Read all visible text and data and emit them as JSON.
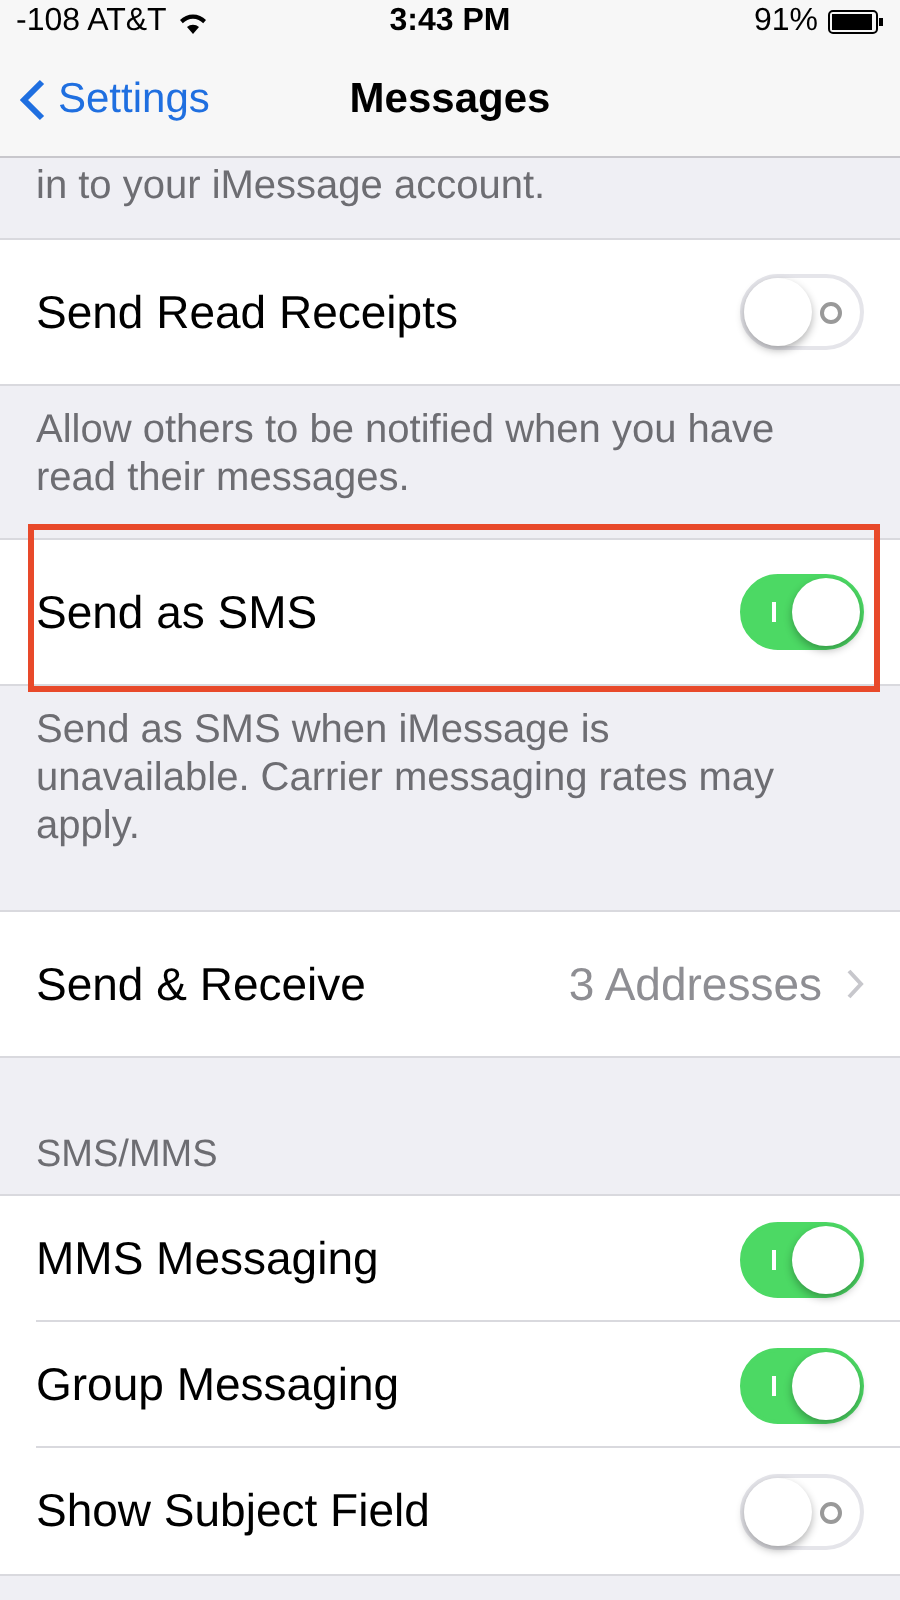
{
  "status_bar": {
    "carrier": "-108 AT&T",
    "time": "3:43 PM",
    "battery": "91%"
  },
  "nav_bar": {
    "back": "Settings",
    "title": "Messages"
  },
  "sections": [
    {
      "kind": "note",
      "text": "in to your iMessage account."
    },
    {
      "kind": "group",
      "rows": [
        {
          "kind": "toggle",
          "label": "Send Read Receipts",
          "on": false,
          "highlighted": false
        }
      ]
    },
    {
      "kind": "note",
      "text": "Allow others to be notified when you have read their messages."
    },
    {
      "kind": "group",
      "rows": [
        {
          "kind": "toggle",
          "label": "Send as SMS",
          "on": true,
          "highlighted": true
        }
      ]
    },
    {
      "kind": "note",
      "text": "Send as SMS when iMessage is unavailable. Carrier messaging rates may apply."
    },
    {
      "kind": "group",
      "rows": [
        {
          "kind": "detail",
          "label": "Send & Receive",
          "value": "3 Addresses",
          "highlighted": false
        }
      ]
    },
    {
      "kind": "header",
      "text": "SMS/MMS"
    },
    {
      "kind": "group",
      "rows": [
        {
          "kind": "toggle",
          "label": "MMS Messaging",
          "on": true,
          "highlighted": false
        },
        {
          "kind": "toggle",
          "label": "Group Messaging",
          "on": true,
          "highlighted": false
        },
        {
          "kind": "toggle",
          "label": "Show Subject Field",
          "on": false,
          "highlighted": false
        }
      ]
    }
  ]
}
